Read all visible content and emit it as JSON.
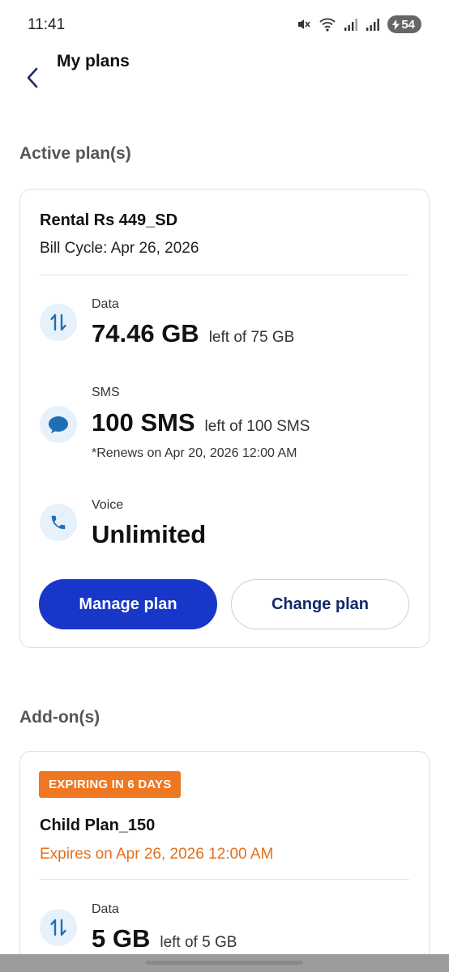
{
  "status": {
    "time": "11:41",
    "battery": "54",
    "icons": [
      "mute-vibrate-icon",
      "wifi-icon",
      "signal-icon",
      "signal-icon",
      "battery-charging-icon"
    ]
  },
  "header": {
    "title": "My plans",
    "back_icon": "chevron-left-icon"
  },
  "active_section": {
    "title": "Active plan(s)",
    "plan": {
      "name": "Rental Rs 449_SD",
      "bill_cycle": "Bill Cycle: Apr 26, 2026",
      "usage": [
        {
          "label": "Data",
          "value": "74.46 GB",
          "remaining": "left of 75 GB",
          "icon": "data-transfer-icon"
        },
        {
          "label": "SMS",
          "value": "100 SMS",
          "remaining": "left of 100 SMS",
          "note": "*Renews on Apr 20, 2026 12:00 AM",
          "icon": "chat-bubble-icon"
        },
        {
          "label": "Voice",
          "value": "Unlimited",
          "icon": "phone-icon"
        }
      ],
      "manage_label": "Manage plan",
      "change_label": "Change plan"
    }
  },
  "addon_section": {
    "title": "Add-on(s)",
    "plan": {
      "badge": "EXPIRING IN 6 DAYS",
      "name": "Child Plan_150",
      "expires": "Expires on Apr 26, 2026 12:00 AM",
      "usage": [
        {
          "label": "Data",
          "value": "5 GB",
          "remaining": "left of 5 GB",
          "icon": "data-transfer-icon"
        }
      ]
    }
  },
  "colors": {
    "primary": "#1836c8",
    "icon_blue": "#1f6fb5",
    "icon_bg": "#e7f1fb",
    "orange": "#ee7722"
  }
}
